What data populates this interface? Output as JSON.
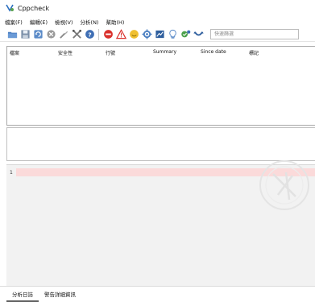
{
  "window": {
    "title": "Cppcheck",
    "icon": "cppcheck-logo-icon"
  },
  "menu": [
    {
      "label": "檔案(F)"
    },
    {
      "label": "編輯(E)"
    },
    {
      "label": "檢視(V)"
    },
    {
      "label": "分析(N)"
    },
    {
      "label": "幫助(H)"
    }
  ],
  "toolbar": {
    "buttons": [
      {
        "icon": "open-folder-icon"
      },
      {
        "icon": "save-icon"
      },
      {
        "icon": "recheck-icon"
      },
      {
        "icon": "stop-icon"
      },
      {
        "icon": "clear-icon"
      },
      {
        "icon": "settings-tools-icon"
      },
      {
        "icon": "help-icon"
      },
      {
        "icon": "show-errors-icon"
      },
      {
        "icon": "show-warnings-icon"
      },
      {
        "icon": "show-style-icon"
      },
      {
        "icon": "show-portability-icon"
      },
      {
        "icon": "show-performance-icon"
      },
      {
        "icon": "show-information-icon"
      },
      {
        "icon": "check-all-icon"
      },
      {
        "icon": "collapse-all-icon"
      }
    ],
    "filter_placeholder": "快速篩選"
  },
  "results": {
    "columns": [
      "檔案",
      "安全性",
      "行號",
      "Summary",
      "Since date",
      "標記"
    ]
  },
  "editor": {
    "line_number": "1"
  },
  "tabs": [
    {
      "label": "分析日誌",
      "active": true
    },
    {
      "label": "警告詳細資訊",
      "active": false
    }
  ],
  "colors": {
    "highlight_line": "#fbdada",
    "editor_bg": "#f2f2f2"
  }
}
